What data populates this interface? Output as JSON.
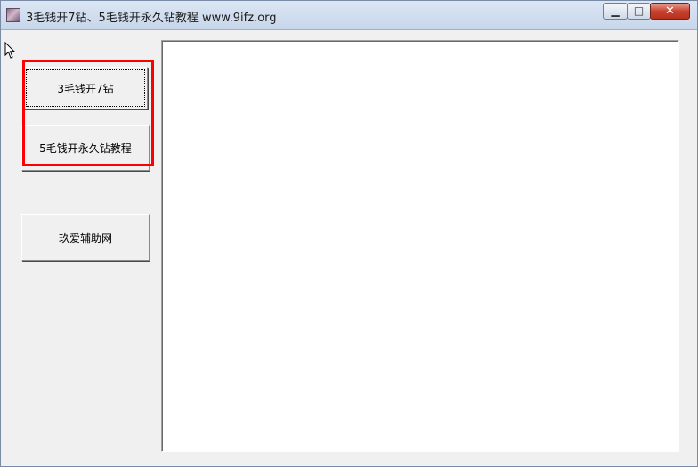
{
  "window": {
    "title": "3毛钱开7钻、5毛钱开永久钻教程  www.9ifz.org",
    "controls": {
      "minimize": "▁",
      "maximize": "□",
      "close": "✕"
    }
  },
  "buttons": [
    {
      "label": "3毛钱开7钻"
    },
    {
      "label": "5毛钱开永久钻教程"
    },
    {
      "label": "玖爱辅助网"
    }
  ],
  "colors": {
    "highlight": "#ff0000",
    "titlebar": "#c7d6ea",
    "panel": "#ffffff"
  },
  "icons": [
    "app-icon",
    "mouse-cursor-icon"
  ]
}
